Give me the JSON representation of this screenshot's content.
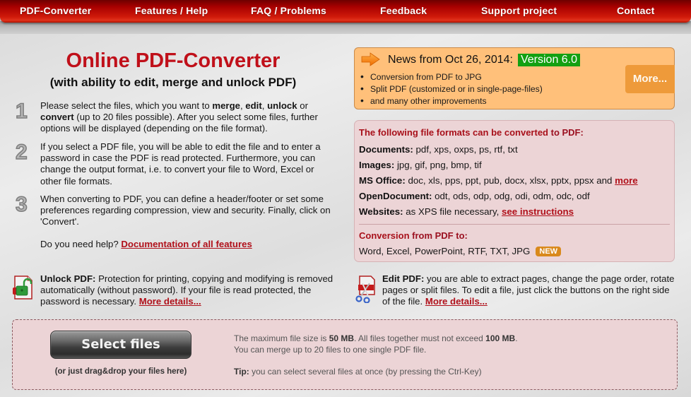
{
  "nav": {
    "items": [
      {
        "label": "PDF-Converter"
      },
      {
        "label": "Features / Help"
      },
      {
        "label": "FAQ / Problems"
      },
      {
        "label": "Feedback"
      },
      {
        "label": "Support project"
      },
      {
        "label": "Contact"
      }
    ]
  },
  "header": {
    "title": "Online PDF-Converter",
    "subtitle": "(with ability to edit, merge and unlock PDF)"
  },
  "steps": [
    {
      "number": "1",
      "text_a": "Please select the files, which you want to ",
      "merge": "merge",
      "sep1": ", ",
      "edit": "edit",
      "sep2": ", ",
      "unlock": "unlock",
      "text_b": " or ",
      "convert": "convert",
      "text_c": " (up to 20 files possible). After you select some files, further options will be displayed (depending on the file format)."
    },
    {
      "number": "2",
      "text": "If you select a PDF file, you will be able to edit the file and to enter a password in case the PDF is read protected. Furthermore, you can change the output format, i.e. to convert your file to Word, Excel or other file formats."
    },
    {
      "number": "3",
      "text": "When converting to PDF, you can define a header/footer or set some preferences regarding compression, view and security. Finally, click on 'Convert'."
    }
  ],
  "help": {
    "question": "Do you need help? ",
    "link": "Documentation of all features"
  },
  "news": {
    "icon": "arrow-right-icon",
    "headline": "News from Oct 26, 2014:",
    "version": "Version 6.0",
    "items": [
      "Conversion from PDF to JPG",
      "Split PDF (customized or in single-page-files)",
      "and many other improvements"
    ],
    "more_label": "More...",
    "colors": {
      "background": "#ffc07a",
      "version_badge": "#13a012",
      "more_button": "#ee9a3a"
    }
  },
  "formats": {
    "heading_a": "The following file formats can be converted ",
    "heading_b": "to PDF:",
    "rows": [
      {
        "label": "Documents:",
        "value": " pdf, xps, oxps, ps, rtf, txt"
      },
      {
        "label": "Images:",
        "value": " jpg, gif, png, bmp, tif"
      },
      {
        "label": "MS Office:",
        "value": " doc, xls, pps, ppt, pub, docx, xlsx, pptx, ppsx and ",
        "link": "more"
      },
      {
        "label": "OpenDocument:",
        "value": " odt, ods, odp, odg, odi, odm, odc, odf"
      },
      {
        "label": "Websites:",
        "value": " as XPS file necessary, ",
        "link": "see instructions"
      }
    ],
    "from_heading_a": "Conversion ",
    "from_heading_b": "from PDF to:",
    "from_value": "Word, Excel, PowerPoint, RTF, TXT, JPG",
    "new_badge": "NEW",
    "colors": {
      "heading": "#a8101a",
      "background": "#ecd4d6",
      "new_badge": "#d9891c"
    }
  },
  "features": {
    "unlock": {
      "icon": "unlock-pdf-icon",
      "label": "Unlock PDF:",
      "text": " Protection for printing, copying and modifying is removed automatically (without password). If your file is read protected, the password is necessary. ",
      "link": "More details..."
    },
    "edit": {
      "icon": "edit-pdf-scissors-icon",
      "label": "Edit PDF:",
      "text": " you are able to extract pages, change the page order, rotate pages or split files. To edit a file, just click the buttons on the right side of the file. ",
      "link": "More details..."
    }
  },
  "upload": {
    "button_label": "Select files",
    "drag_hint": "(or just drag&drop your files here)",
    "limit_a": "The maximum file size is ",
    "limit_file": "50 MB",
    "limit_b": ". All files together must not exceed ",
    "limit_total": "100 MB",
    "limit_c": ".",
    "merge_info": "You can merge up to 20 files to one single PDF file.",
    "tip_label": "Tip:",
    "tip_text": " you can select several files at once (by pressing the Ctrl-Key)"
  }
}
